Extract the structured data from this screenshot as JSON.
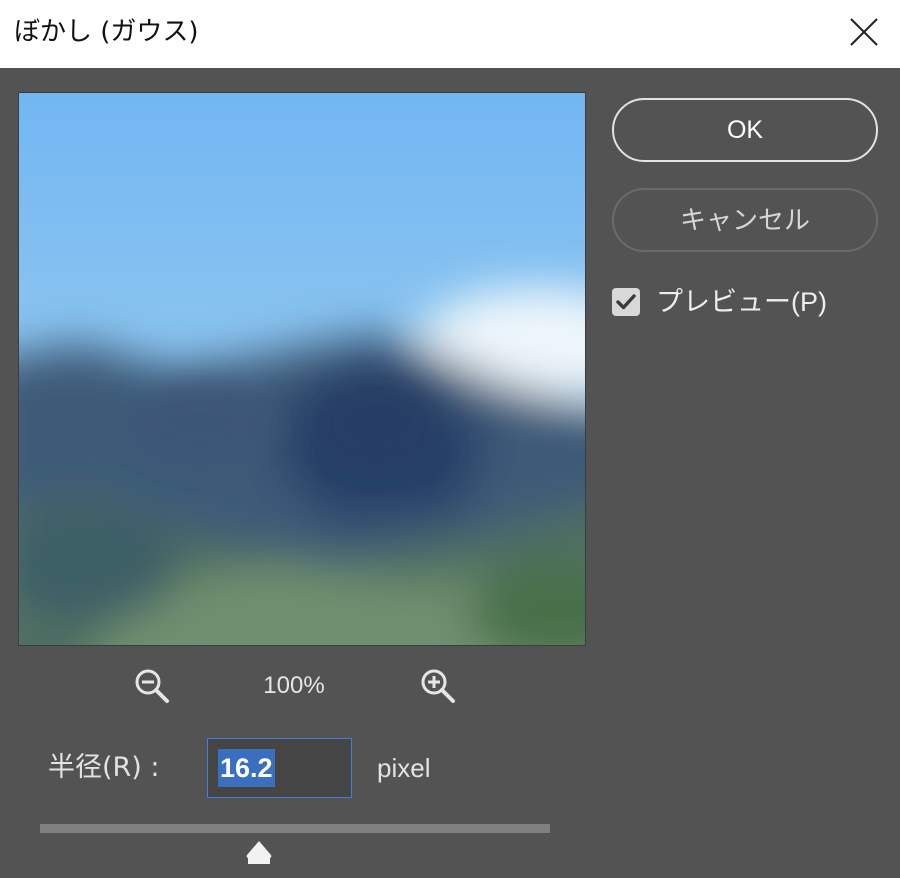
{
  "window": {
    "title": "ぼかし (ガウス)"
  },
  "buttons": {
    "ok": "OK",
    "cancel": "キャンセル"
  },
  "preview_option": {
    "label": "プレビュー(P)",
    "checked": true
  },
  "zoom": {
    "level": "100%"
  },
  "radius": {
    "label": "半径(R) :",
    "value": "16.2",
    "unit": "pixel",
    "slider_fraction": 0.43
  },
  "icons": {
    "close": "close-icon",
    "zoom_out": "zoom-out-icon",
    "zoom_in": "zoom-in-icon",
    "check": "check-icon"
  },
  "colors": {
    "dialog_bg": "#535353",
    "titlebar_bg": "#ffffff",
    "accent": "#3f80d8",
    "selection": "#3a6fc0"
  }
}
